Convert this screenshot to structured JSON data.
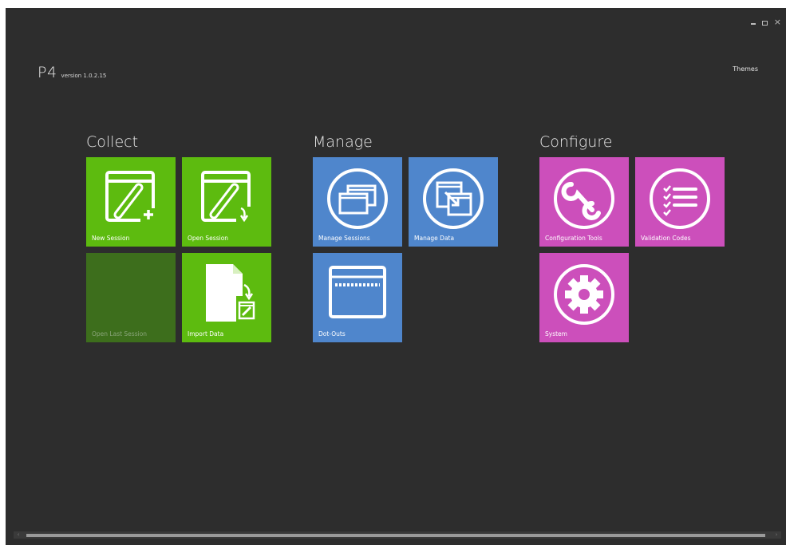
{
  "app": {
    "name": "P4",
    "version": "version 1.0.2.15",
    "themes_label": "Themes"
  },
  "window_controls": {
    "minimize": "minimize",
    "maximize": "maximize",
    "close": "×"
  },
  "groups": {
    "collect": {
      "title": "Collect",
      "tiles": {
        "new_session": "New Session",
        "open_session": "Open Session",
        "open_last_session": "Open Last Session",
        "import_data": "Import Data"
      }
    },
    "manage": {
      "title": "Manage",
      "tiles": {
        "manage_sessions": "Manage Sessions",
        "manage_data": "Manage Data",
        "dot_outs": "Dot-Outs"
      }
    },
    "configure": {
      "title": "Configure",
      "tiles": {
        "configuration_tools": "Configuration Tools",
        "validation_codes": "Validation Codes",
        "system": "System"
      }
    }
  },
  "colors": {
    "background": "#2d2d2d",
    "collect_green": "#5dbb0f",
    "collect_disabled": "#3d6e1c",
    "manage_blue": "#4f86cc",
    "configure_magenta": "#cc4fbb"
  }
}
